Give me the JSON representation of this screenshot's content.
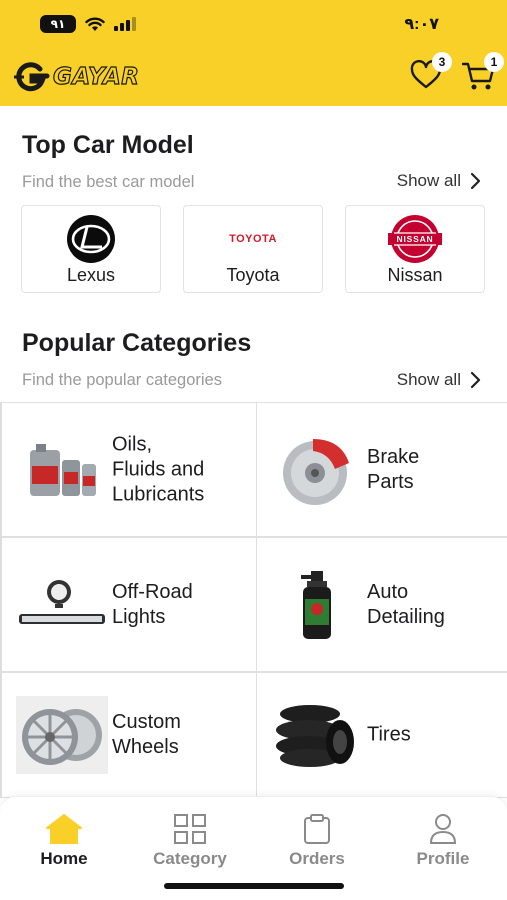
{
  "status_bar": {
    "battery": "٩١",
    "time": "٩:٠٧"
  },
  "header": {
    "logo_text": "GAYAR",
    "wishlist_icon": "heart-icon",
    "wishlist_count": "3",
    "cart_icon": "cart-icon",
    "cart_count": "1"
  },
  "top_models": {
    "title": "Top Car Model",
    "subtitle": "Find the best car model",
    "show_all": "Show all",
    "brands": [
      {
        "name": "Lexus",
        "logo_text": ""
      },
      {
        "name": "Toyota",
        "logo_text": "TOYOTA"
      },
      {
        "name": "Nissan",
        "logo_text": "NISSAN"
      }
    ]
  },
  "categories": {
    "title": "Popular Categories",
    "subtitle": "Find the popular categories",
    "show_all": "Show all",
    "items": [
      {
        "label": "Oils,\nFluids and\nLubricants"
      },
      {
        "label": "Brake\nParts"
      },
      {
        "label": "Off-Road\nLights"
      },
      {
        "label": "Auto\nDetailing"
      },
      {
        "label": "Custom\nWheels"
      },
      {
        "label": "Tires"
      }
    ]
  },
  "bottom_nav": [
    {
      "label": "Home",
      "icon": "home-icon",
      "active": true
    },
    {
      "label": "Category",
      "icon": "grid-icon",
      "active": false
    },
    {
      "label": "Orders",
      "icon": "clipboard-icon",
      "active": false
    },
    {
      "label": "Profile",
      "icon": "person-icon",
      "active": false
    }
  ],
  "colors": {
    "brand_yellow": "#F9D027",
    "text_dark": "#1D1D1F",
    "text_muted": "#9A9A9A",
    "nissan_red": "#C3002F"
  }
}
